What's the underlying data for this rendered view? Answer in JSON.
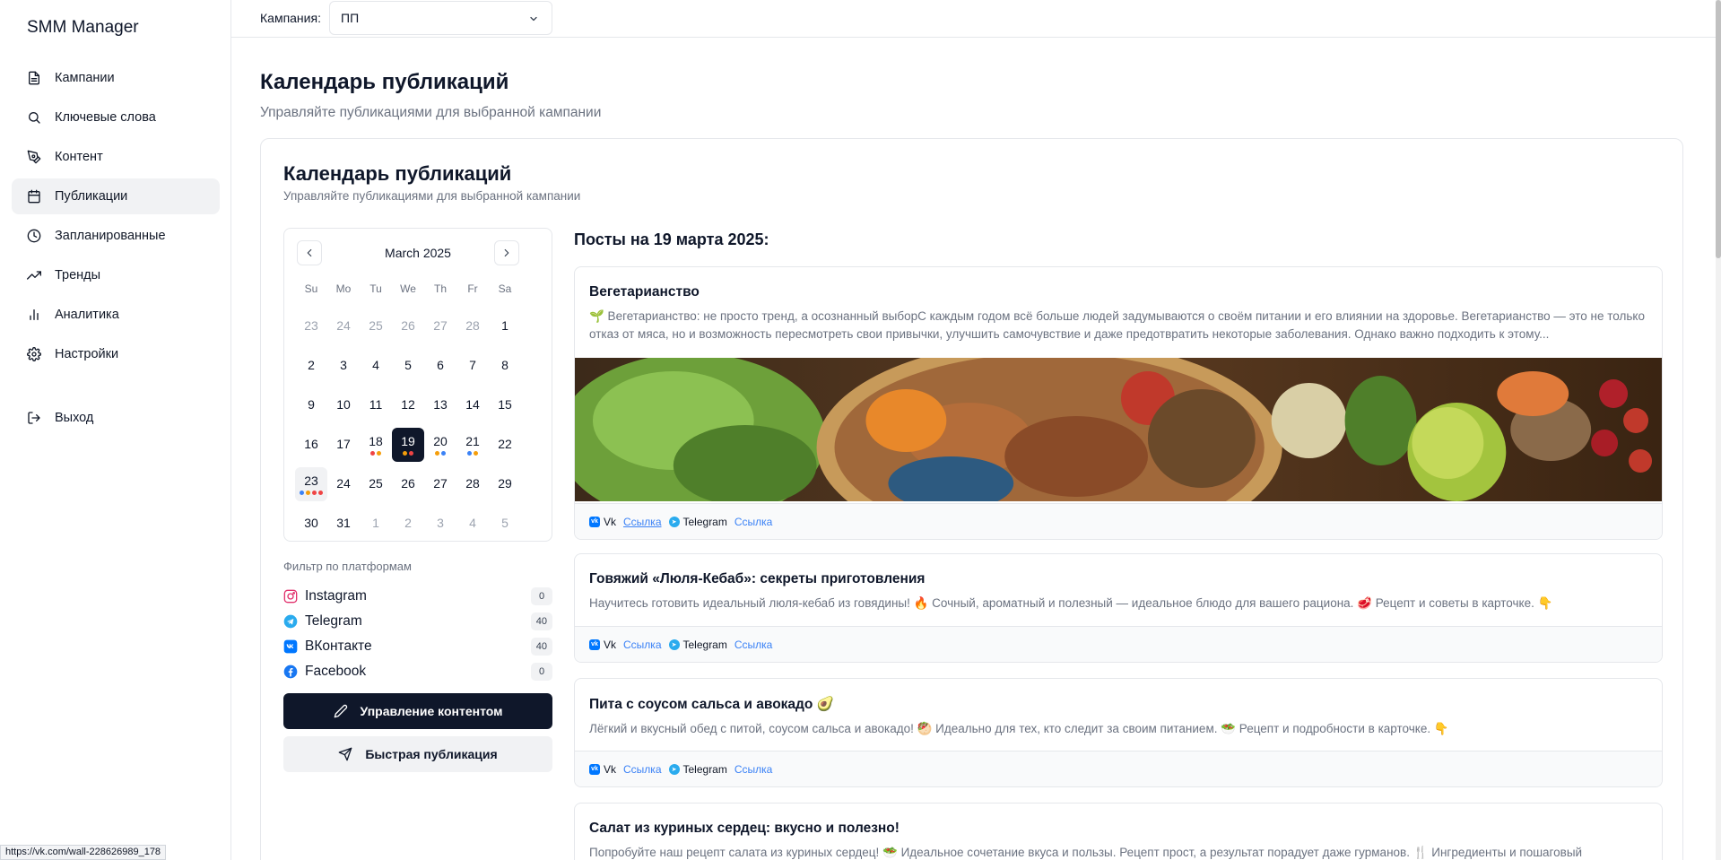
{
  "app": {
    "title": "SMM Manager"
  },
  "nav": {
    "items": [
      {
        "label": "Кампании",
        "icon": "file-icon"
      },
      {
        "label": "Ключевые слова",
        "icon": "search-icon"
      },
      {
        "label": "Контент",
        "icon": "pen-tool-icon"
      },
      {
        "label": "Публикации",
        "icon": "calendar-icon",
        "active": true
      },
      {
        "label": "Запланированные",
        "icon": "clock-icon"
      },
      {
        "label": "Тренды",
        "icon": "trending-up-icon"
      },
      {
        "label": "Аналитика",
        "icon": "bar-chart-icon"
      },
      {
        "label": "Настройки",
        "icon": "gear-icon"
      }
    ],
    "logout": "Выход"
  },
  "topbar": {
    "campaign_label": "Кампания:",
    "campaign_value": "ПП"
  },
  "page": {
    "title": "Календарь публикаций",
    "subtitle": "Управляйте публикациями для выбранной кампании"
  },
  "card": {
    "title": "Календарь публикаций",
    "subtitle": "Управляйте публикациями для выбранной кампании"
  },
  "calendar": {
    "month": "March 2025",
    "weekdays": [
      "Su",
      "Mo",
      "Tu",
      "We",
      "Th",
      "Fr",
      "Sa"
    ],
    "selected": "19",
    "today": "23",
    "weeks": [
      [
        {
          "d": "23",
          "o": true
        },
        {
          "d": "24",
          "o": true
        },
        {
          "d": "25",
          "o": true
        },
        {
          "d": "26",
          "o": true
        },
        {
          "d": "27",
          "o": true
        },
        {
          "d": "28",
          "o": true
        },
        {
          "d": "1"
        }
      ],
      [
        {
          "d": "2"
        },
        {
          "d": "3"
        },
        {
          "d": "4"
        },
        {
          "d": "5"
        },
        {
          "d": "6"
        },
        {
          "d": "7"
        },
        {
          "d": "8"
        }
      ],
      [
        {
          "d": "9"
        },
        {
          "d": "10"
        },
        {
          "d": "11"
        },
        {
          "d": "12"
        },
        {
          "d": "13"
        },
        {
          "d": "14"
        },
        {
          "d": "15"
        }
      ],
      [
        {
          "d": "16"
        },
        {
          "d": "17"
        },
        {
          "d": "18",
          "dots": [
            "#ef4444",
            "#f59e0b"
          ]
        },
        {
          "d": "19",
          "dots": [
            "#f59e0b",
            "#ef4444"
          ]
        },
        {
          "d": "20",
          "dots": [
            "#f59e0b",
            "#3b82f6"
          ]
        },
        {
          "d": "21",
          "dots": [
            "#3b82f6",
            "#f59e0b"
          ]
        },
        {
          "d": "22"
        }
      ],
      [
        {
          "d": "23",
          "dots": [
            "#3b82f6",
            "#f59e0b",
            "#ef4444",
            "#ef4444"
          ]
        },
        {
          "d": "24"
        },
        {
          "d": "25"
        },
        {
          "d": "26"
        },
        {
          "d": "27"
        },
        {
          "d": "28"
        },
        {
          "d": "29"
        }
      ],
      [
        {
          "d": "30"
        },
        {
          "d": "31"
        },
        {
          "d": "1",
          "o": true
        },
        {
          "d": "2",
          "o": true
        },
        {
          "d": "3",
          "o": true
        },
        {
          "d": "4",
          "o": true
        },
        {
          "d": "5",
          "o": true
        }
      ]
    ]
  },
  "filter": {
    "title": "Фильтр по платформам",
    "platforms": [
      {
        "name": "Instagram",
        "count": "0",
        "icon": "instagram-icon",
        "color": "#e1306c"
      },
      {
        "name": "Telegram",
        "count": "40",
        "icon": "telegram-icon",
        "color": "#2aabee"
      },
      {
        "name": "ВКонтакте",
        "count": "40",
        "icon": "vk-icon",
        "color": "#0077ff"
      },
      {
        "name": "Facebook",
        "count": "0",
        "icon": "facebook-icon",
        "color": "#1877f2"
      }
    ]
  },
  "buttons": {
    "manage": "Управление контентом",
    "quick": "Быстрая публикация"
  },
  "posts": {
    "heading": "Посты на 19 марта 2025:",
    "items": [
      {
        "title": "Вегетарианство",
        "text": "🌱 Вегетарианство: не просто тренд, а осознанный выборС каждым годом всё больше людей задумываются о своём питании и его влиянии на здоровье. Вегетарианство — это не только отказ от мяса, но и возможность пересмотреть свои привычки, улучшить самочувствие и даже предотвратить некоторые заболевания. Однако важно подходить к этому...",
        "vk": "Vk",
        "vk_link": "Ссылка",
        "tg": "Telegram",
        "tg_link": "Ссылка"
      },
      {
        "title": "Говяжий «Люля-Кебаб»: секреты приготовления",
        "text": "Научитесь готовить идеальный люля-кебаб из говядины! 🔥 Сочный, ароматный и полезный — идеальное блюдо для вашего рациона. 🥩 Рецепт и советы в карточке. 👇",
        "vk": "Vk",
        "vk_link": "Ссылка",
        "tg": "Telegram",
        "tg_link": "Ссылка"
      },
      {
        "title": "Пита с соусом сальса и авокадо 🥑",
        "text": "Лёгкий и вкусный обед с питой, соусом сальса и авокадо! 🥙 Идеально для тех, кто следит за своим питанием. 🥗 Рецепт и подробности в карточке. 👇",
        "vk": "Vk",
        "vk_link": "Ссылка",
        "tg": "Telegram",
        "tg_link": "Ссылка"
      },
      {
        "title": "Салат из куриных сердец: вкусно и полезно!",
        "text": "Попробуйте наш рецепт салата из куриных сердец! 🥗 Идеальное сочетание вкуса и пользы. Рецепт прост, а результат порадует даже гурманов. 🍴 Ингредиенты и пошаговый"
      }
    ]
  },
  "status": {
    "url": "https://vk.com/wall-228626989_178"
  }
}
